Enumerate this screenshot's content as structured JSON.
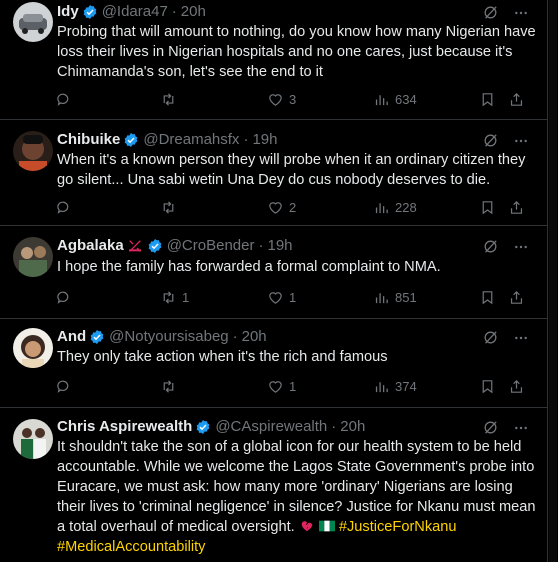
{
  "tweets": [
    {
      "name": "Idy",
      "handle": "@Idara47",
      "time": "20h",
      "text": "Probing that will amount to nothing, do you know how many Nigerian have loss their lives in Nigerian hospitals and no one cares, just because it's Chimamanda's son, let's see the end to it",
      "retweets": "",
      "likes": "3",
      "views": "634"
    },
    {
      "name": "Chibuike",
      "handle": "@Dreamahsfx",
      "time": "19h",
      "text": "When it's a known person they will probe when it an ordinary citizen they go silent... Una sabi wetin Una Dey do cus nobody deserves  to die.",
      "retweets": "",
      "likes": "2",
      "views": "228"
    },
    {
      "name": "Agbalaka",
      "handle": "@CroBender",
      "time": "19h",
      "text": "I hope the family has forwarded a formal complaint to NMA.",
      "retweets": "1",
      "likes": "1",
      "views": "851"
    },
    {
      "name": "And",
      "handle": "@Notyoursisabeg",
      "time": "20h",
      "text": "They only take action when it's the rich and famous",
      "retweets": "",
      "likes": "1",
      "views": "374"
    },
    {
      "name": "Chris Aspirewealth",
      "handle": "@CAspirewealth",
      "time": "20h",
      "text": "It shouldn't take the son of a global icon for our health system to be held accountable. While we welcome the Lagos State Government's probe into Euracare, we must ask: how many more 'ordinary' Nigerians are losing their lives to 'criminal negligence' in silence? Justice for Nkanu must mean a total overhaul of medical oversight.",
      "hashtag1": "#JusticeForNkanu",
      "hashtag2": "#MedicalAccountability"
    }
  ],
  "separator": "·",
  "colors": {
    "background": "#000000",
    "text": "#e7e9ea",
    "muted": "#71767b",
    "verified": "#1d9bf0",
    "hashtag": "#ffd400",
    "border": "#2f3336"
  }
}
